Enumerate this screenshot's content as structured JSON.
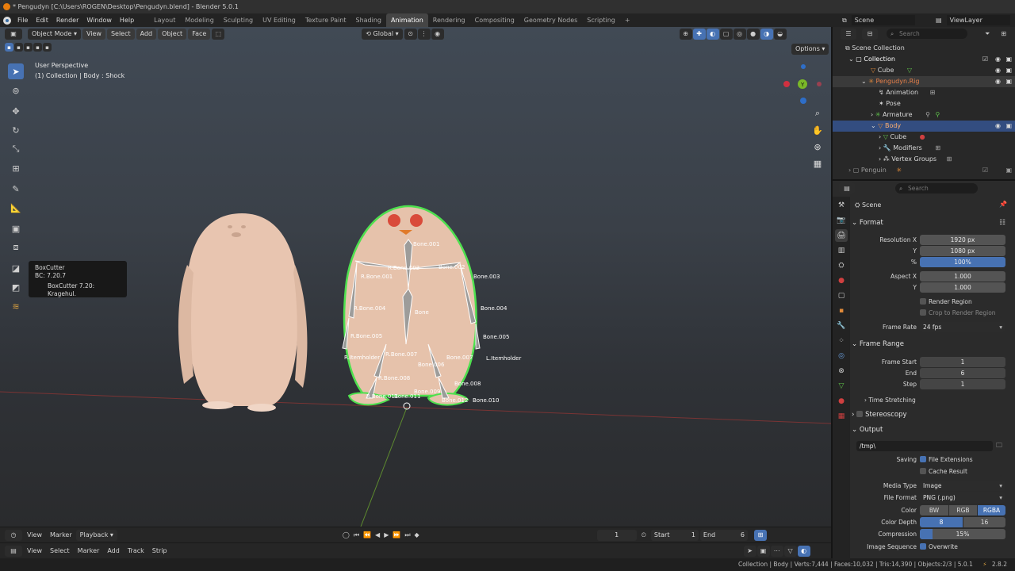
{
  "title": "* Pengudyn [C:\\Users\\ROGEN\\Desktop\\Pengudyn.blend] - Blender 5.0.1",
  "menu": [
    "File",
    "Edit",
    "Render",
    "Window",
    "Help"
  ],
  "workspaces": [
    "Layout",
    "Modeling",
    "Sculpting",
    "UV Editing",
    "Texture Paint",
    "Shading",
    "Animation",
    "Rendering",
    "Compositing",
    "Geometry Nodes",
    "Scripting"
  ],
  "workspace_add": "+",
  "viewport_header": {
    "mode": "Object Mode",
    "menus": [
      "View",
      "Select",
      "Add",
      "Object",
      "Face"
    ],
    "orientation": "Global",
    "options": "Options"
  },
  "overlay": {
    "view_name": "User Perspective",
    "context": "(1) Collection | Body : Shock"
  },
  "tooltip": {
    "title": "BoxCutter",
    "version": "BC: 7.20.7",
    "detail": "BoxCutter 7.20: Kragehul."
  },
  "bones": {
    "b001": "Bone.001",
    "b002": "Bone.002",
    "b003": "Bone.003",
    "b004": "Bone.004",
    "b005": "Bone.005",
    "b007": "Bone.007",
    "b008": "Bone.008",
    "b010": "Bone.010",
    "lhold": "L.Itemholder",
    "rhold": "R.Itemholder",
    "bone": "Bone",
    "rb001": "R.Bone.001",
    "rb002": "R.Bone.002",
    "rb004": "R.Bone.004",
    "rb005": "R.Bone.005",
    "rb007": "R.Bone.007",
    "rb008": "R.Bone.008",
    "rb011": "R.Bone.011",
    "b009": "Bone.009",
    "b006": "Bone.006",
    "b011": "Bone.011",
    "b012": "Bone.012"
  },
  "timeline": {
    "menus": [
      "View",
      "Marker",
      "Playback"
    ],
    "current_frame": "1",
    "start_label": "Start",
    "start": "1",
    "end_label": "End",
    "end": "6"
  },
  "sequencer": {
    "menus": [
      "View",
      "Select",
      "Marker",
      "Add",
      "Track",
      "Strip"
    ]
  },
  "status": "Collection | Body | Verts:7,444 | Faces:10,032 | Tris:14,390 | Objects:2/3 | 5.0.1",
  "status_version": "2.8.2",
  "topright": {
    "scene": "Scene",
    "view_layer": "ViewLayer"
  },
  "outliner": {
    "search": "Search",
    "rows": [
      {
        "label": "Scene Collection"
      },
      {
        "label": "Collection"
      },
      {
        "label": "Cube"
      },
      {
        "label": "Pengudyn.Rig"
      },
      {
        "label": "Animation"
      },
      {
        "label": "Pose"
      },
      {
        "label": "Armature"
      },
      {
        "label": "Body"
      },
      {
        "label": "Cube"
      },
      {
        "label": "Modifiers"
      },
      {
        "label": "Vertex Groups"
      },
      {
        "label": "Penguin"
      }
    ]
  },
  "properties": {
    "search": "Search",
    "scene": "Scene",
    "format": {
      "header": "Format",
      "res_x_label": "Resolution X",
      "res_x": "1920 px",
      "res_y_label": "Y",
      "res_y": "1080 px",
      "pct_label": "%",
      "pct": "100%",
      "aspect_x_label": "Aspect X",
      "aspect_x": "1.000",
      "aspect_y_label": "Y",
      "aspect_y": "1.000",
      "render_region": "Render Region",
      "crop": "Crop to Render Region",
      "fps_label": "Frame Rate",
      "fps": "24 fps"
    },
    "frame_range": {
      "header": "Frame Range",
      "start_label": "Frame Start",
      "start": "1",
      "end_label": "End",
      "end": "6",
      "step_label": "Step",
      "step": "1",
      "stretch": "Time Stretching"
    },
    "stereo": "Stereoscopy",
    "output": {
      "header": "Output",
      "path": "/tmp\\",
      "saving_label": "Saving",
      "file_ext": "File Extensions",
      "cache": "Cache Result",
      "media_label": "Media Type",
      "media": "Image",
      "format_label": "File Format",
      "format": "PNG (.png)",
      "color_label": "Color",
      "color_opts": [
        "BW",
        "RGB",
        "RGBA"
      ],
      "depth_label": "Color Depth",
      "depth_opts": [
        "8",
        "16"
      ],
      "compression_label": "Compression",
      "compression": "15%",
      "compression_value": 0.15,
      "seq_label": "Image Sequence",
      "overwrite": "Overwrite"
    }
  },
  "colors": {
    "accent": "#4772b3",
    "selected_outline": "#4ee04e",
    "penguin": "#e8c5b0"
  }
}
